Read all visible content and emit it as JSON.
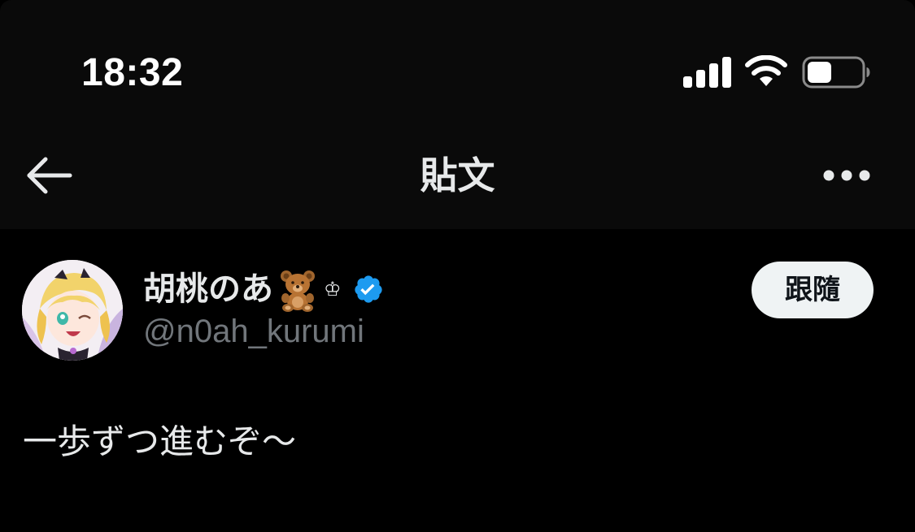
{
  "status_bar": {
    "time": "18:32",
    "signal_icon": "cellular-signal-icon",
    "wifi_icon": "wifi-icon",
    "battery_icon": "battery-icon",
    "battery_level": 0.45
  },
  "nav": {
    "back_icon": "arrow-left-icon",
    "title": "貼文",
    "more_icon": "more-horizontal-icon"
  },
  "post": {
    "author": {
      "display_name": "胡桃のあ",
      "name_emoji": "teddy-bear-icon",
      "name_suffix": "♔",
      "verified_icon": "verified-badge-icon",
      "handle": "@n0ah_kurumi"
    },
    "follow_label": "跟隨",
    "text": "一歩ずつ進むぞ〜"
  },
  "colors": {
    "background": "#000000",
    "chrome_background": "#0a0a0a",
    "primary_text": "#e7e9ea",
    "secondary_text": "#71767b",
    "verified_blue": "#1d9bf0",
    "follow_button_bg": "#eff3f4",
    "follow_button_text": "#0f1419"
  }
}
